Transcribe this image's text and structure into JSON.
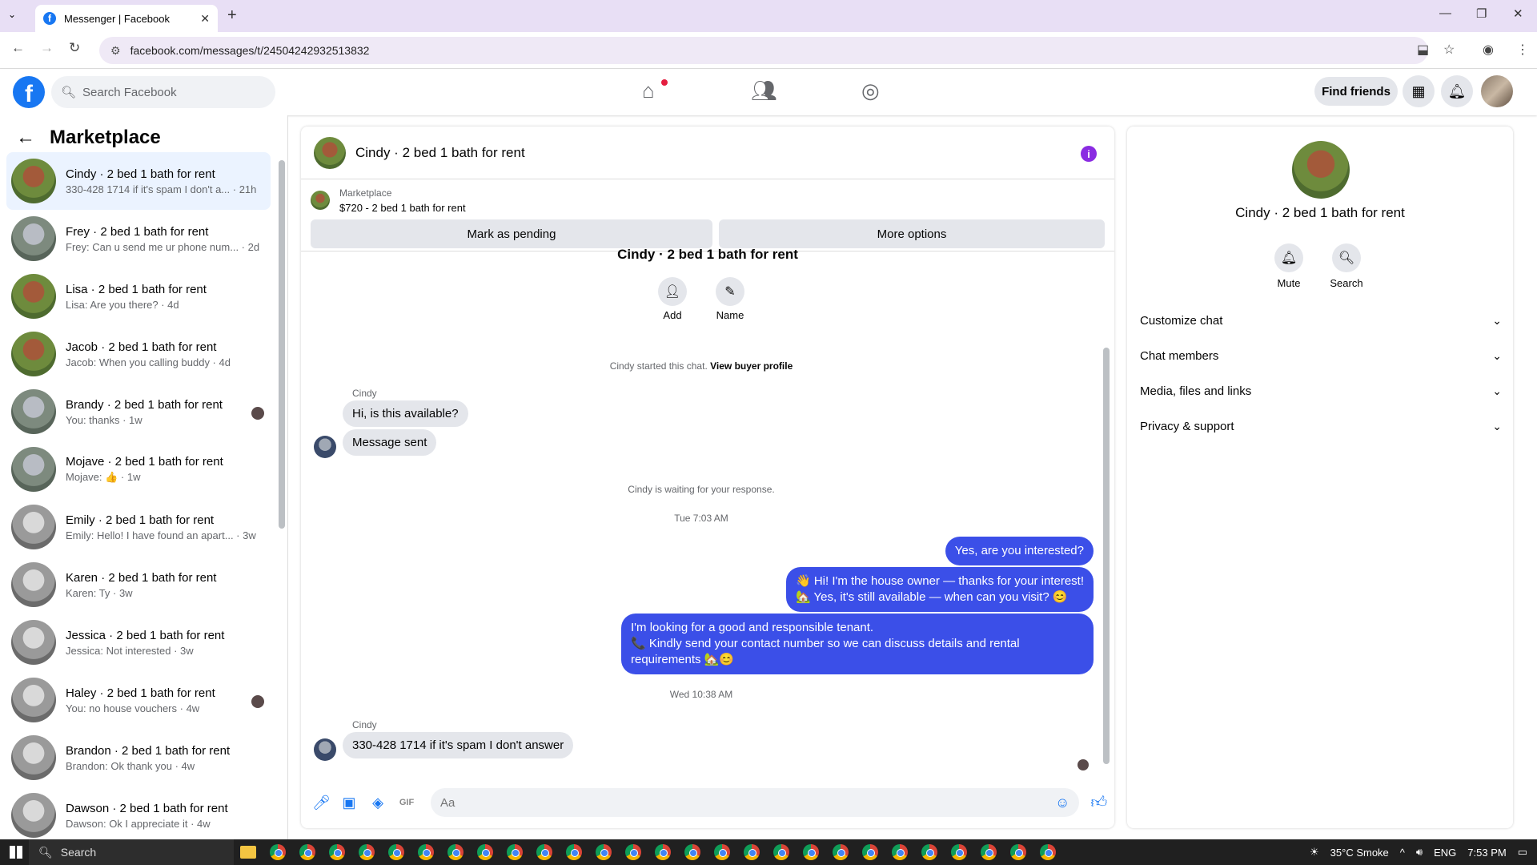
{
  "browser": {
    "tab_title": "Messenger | Facebook",
    "url": "facebook.com/messages/t/24504242932513832"
  },
  "fb": {
    "search_placeholder": "Search Facebook",
    "find_friends": "Find friends"
  },
  "sidebar": {
    "title": "Marketplace",
    "conversations": [
      {
        "name": "Cindy · 2 bed 1 bath for rent",
        "preview": "330-428 1714 if it's spam I don't a... · 21h",
        "thumb": "red",
        "active": true
      },
      {
        "name": "Frey · 2 bed 1 bath for rent",
        "preview": "Frey: Can u send me ur phone num... · 2d",
        "thumb": "gray"
      },
      {
        "name": "Lisa · 2 bed 1 bath for rent",
        "preview": "Lisa: Are you there? · 4d",
        "thumb": "red"
      },
      {
        "name": "Jacob · 2 bed 1 bath for rent",
        "preview": "Jacob: When you calling buddy · 4d",
        "thumb": "red"
      },
      {
        "name": "Brandy · 2 bed 1 bath for rent",
        "preview": "You: thanks · 1w",
        "thumb": "gray",
        "seen": true
      },
      {
        "name": "Mojave · 2 bed 1 bath for rent",
        "preview": "Mojave: 👍 · 1w",
        "thumb": "gray"
      },
      {
        "name": "Emily · 2 bed 1 bath for rent",
        "preview": "Emily: Hello! I have found an apart... · 3w",
        "thumb": "bw"
      },
      {
        "name": "Karen · 2 bed 1 bath for rent",
        "preview": "Karen: Ty · 3w",
        "thumb": "bw"
      },
      {
        "name": "Jessica · 2 bed 1 bath for rent",
        "preview": "Jessica: Not interested · 3w",
        "thumb": "bw"
      },
      {
        "name": "Haley · 2 bed 1 bath for rent",
        "preview": "You: no house vouchers · 4w",
        "thumb": "bw",
        "seen": true
      },
      {
        "name": "Brandon · 2 bed 1 bath for rent",
        "preview": "Brandon: Ok thank you · 4w",
        "thumb": "bw"
      },
      {
        "name": "Dawson · 2 bed 1 bath for rent",
        "preview": "Dawson: Ok I appreciate it · 4w",
        "thumb": "bw"
      }
    ]
  },
  "chat": {
    "title": "Cindy · 2 bed 1 bath for rent",
    "marketplace_label": "Marketplace",
    "listing": "$720 - 2 bed 1 bath for rent",
    "mark_pending": "Mark as pending",
    "more_options": "More options",
    "cut_title": "Cindy · 2 bed 1 bath for rent",
    "add_label": "Add",
    "name_label": "Name",
    "started": "Cindy started this chat.",
    "view_profile": "View buyer profile",
    "sender1": "Cindy",
    "msg1": "Hi, is this available?",
    "msg2": "Message sent",
    "waiting": "Cindy is waiting for your response.",
    "time1": "Tue 7:03 AM",
    "out1": "Yes, are you interested?",
    "out2_l1": "👋 Hi! I'm the house owner — thanks for your interest!",
    "out2_l2": "🏡 Yes, it's still available — when can you visit? 😊",
    "out3_l1": "I'm looking for a good and responsible tenant.",
    "out3_l2": "📞 Kindly send your contact number so we can discuss details and rental",
    "out3_l3": "requirements 🏡😊",
    "time2": "Wed 10:38 AM",
    "sender2": "Cindy",
    "msg3": "330-428 1714 if it's spam I don't answer",
    "composer_placeholder": "Aa"
  },
  "details": {
    "name": "Cindy · 2 bed 1 bath for rent",
    "mute": "Mute",
    "search": "Search",
    "sections": [
      "Customize chat",
      "Chat members",
      "Media, files and links",
      "Privacy & support"
    ]
  },
  "taskbar": {
    "search": "Search",
    "weather": "35°C  Smoke",
    "lang": "ENG",
    "time": "7:53 PM"
  }
}
